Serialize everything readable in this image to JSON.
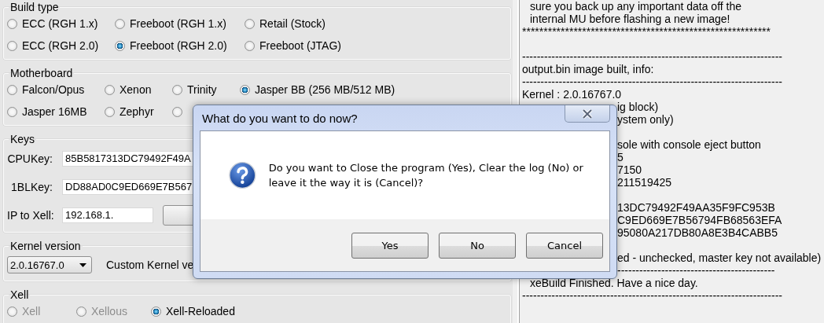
{
  "build_type": {
    "title": "Build type",
    "options": [
      {
        "label": "ECC (RGH 1.x)",
        "selected": false
      },
      {
        "label": "Freeboot (RGH 1.x)",
        "selected": false
      },
      {
        "label": "Retail (Stock)",
        "selected": false
      },
      {
        "label": "ECC (RGH 2.0)",
        "selected": false
      },
      {
        "label": "Freeboot (RGH 2.0)",
        "selected": true
      },
      {
        "label": "Freeboot (JTAG)",
        "selected": false
      }
    ]
  },
  "motherboard": {
    "title": "Motherboard",
    "rows": [
      [
        {
          "label": "Falcon/Opus",
          "selected": false
        },
        {
          "label": "Xenon",
          "selected": false
        },
        {
          "label": "Trinity",
          "selected": false
        },
        {
          "label": "Jasper BB (256 MB/512 MB)",
          "selected": true
        }
      ],
      [
        {
          "label": "Jasper 16MB",
          "selected": false
        },
        {
          "label": "Zephyr",
          "selected": false
        },
        {
          "selected": false
        }
      ]
    ]
  },
  "keys": {
    "title": "Keys",
    "fields": [
      {
        "label": "CPUKey:",
        "value": "85B5817313DC79492F49A"
      },
      {
        "label": "1BLKey:",
        "value": "DD88AD0C9ED669E7B567"
      },
      {
        "label": "IP to Xell:",
        "value": "192.168.1."
      }
    ]
  },
  "kernel_version": {
    "title": "Kernel version",
    "selected": "2.0.16767.0",
    "custom_label": "Custom Kernel ve"
  },
  "xell": {
    "title": "Xell",
    "options": [
      {
        "label": "Xell",
        "selected": false,
        "disabled": true
      },
      {
        "label": "Xellous",
        "selected": false,
        "disabled": true
      },
      {
        "label": "Xell-Reloaded",
        "selected": true,
        "disabled": false
      }
    ]
  },
  "log": [
    {
      "kind": "indented",
      "text": "sure you back up any important data off the"
    },
    {
      "kind": "indented",
      "text": "internal MU before flashing a new image!"
    },
    {
      "kind": "full",
      "text": "**********************************************************"
    },
    {
      "kind": "blank"
    },
    {
      "kind": "full",
      "text": "-----------------------------------------------------------------------"
    },
    {
      "kind": "full",
      "text": "output.bin image built, info:"
    },
    {
      "kind": "full",
      "text": "-----------------------------------------------------------------------"
    },
    {
      "kind": "full",
      "text": "Kernel    : 2.0.16767.0"
    },
    {
      "kind": "fragment",
      "text": "ig block)"
    },
    {
      "kind": "fragment",
      "text": "ystem only)"
    },
    {
      "kind": "blank"
    },
    {
      "kind": "fragment",
      "text": "sole with console eject button"
    },
    {
      "kind": "fragment",
      "text": "5"
    },
    {
      "kind": "fragment",
      "text": "7150"
    },
    {
      "kind": "fragment",
      "text": "211519425"
    },
    {
      "kind": "blank"
    },
    {
      "kind": "fragment",
      "text": "13DC79492F49AA35F9FC953B"
    },
    {
      "kind": "fragment",
      "text": "C9ED669E7B56794FB68563EFA"
    },
    {
      "kind": "fragment",
      "text": "95080A217DB80A8E3B4CABB5"
    },
    {
      "kind": "blank"
    },
    {
      "kind": "fragment",
      "text": "ed - unchecked, master key not available)"
    },
    {
      "kind": "fragment",
      "text": "-------------------------------------------"
    },
    {
      "kind": "indented",
      "text": "xeBuild Finished. Have a nice day."
    },
    {
      "kind": "full",
      "text": "-----------------------------------------------------------------------"
    }
  ],
  "dialog": {
    "title": "What do you want to do now?",
    "message": "Do you want to Close the program (Yes), Clear the log (No) or leave it the way it is (Cancel)?",
    "buttons": [
      "Yes",
      "No",
      "Cancel"
    ]
  }
}
